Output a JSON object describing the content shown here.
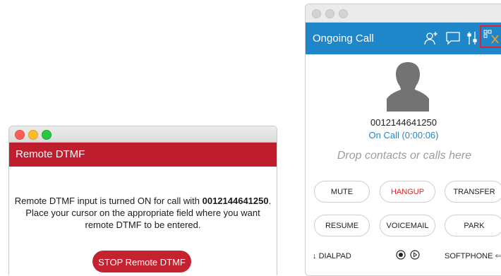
{
  "dtmf_window": {
    "title": "Remote DTMF",
    "message_prefix": "Remote DTMF input is turned ON for call with ",
    "message_number": "0012144641250",
    "message_suffix": ". Place your cursor on the appropriate field where you want remote DTMF to be entered.",
    "stop_button": "STOP Remote DTMF",
    "colors": {
      "header": "#bf1e2e",
      "button": "#c5222f"
    }
  },
  "call_window": {
    "title": "Ongoing Call",
    "header_icons": [
      "add-contact-icon",
      "chat-icon",
      "audio-settings-icon",
      "dialpad-close-icon"
    ],
    "caller_number": "0012144641250",
    "status": "On Call (0:00:06)",
    "drop_zone": "Drop contacts or calls here",
    "buttons_row1": {
      "mute": "MUTE",
      "hangup": "HANGUP",
      "transfer": "TRANSFER"
    },
    "buttons_row2": {
      "resume": "RESUME",
      "voicemail": "VOICEMAIL",
      "park": "PARK"
    },
    "bottom": {
      "dialpad": "DIALPAD",
      "softphone": "SOFTPHONE"
    },
    "colors": {
      "header": "#1f87c9",
      "hangup": "#d42a2a",
      "highlight": "#d9262f"
    }
  }
}
